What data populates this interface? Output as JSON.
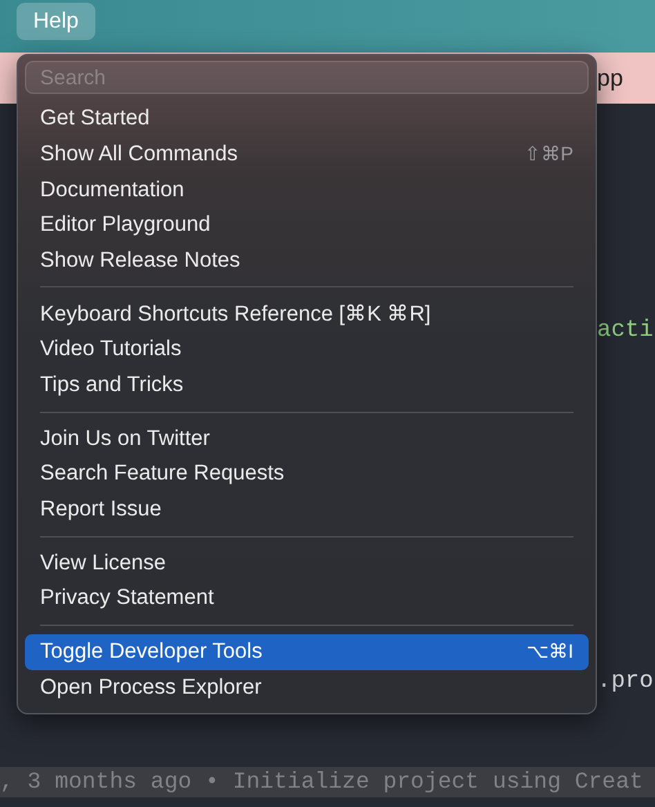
{
  "menubar": {
    "items": [
      {
        "label": "Help",
        "selected": true
      }
    ]
  },
  "banner": {
    "text": "pp"
  },
  "editor": {
    "fragments": [
      {
        "text": "acti",
        "kind": "string"
      },
      {
        "text": ".pro",
        "kind": "code"
      }
    ]
  },
  "blame": ", 3 months ago • Initialize project using Creat",
  "menu": {
    "search": {
      "placeholder": "Search"
    },
    "groups": [
      [
        {
          "label": "Get Started",
          "selected": false
        },
        {
          "label": "Show All Commands",
          "shortcut": "⇧⌘P",
          "selected": false
        },
        {
          "label": "Documentation",
          "selected": false
        },
        {
          "label": "Editor Playground",
          "selected": false
        },
        {
          "label": "Show Release Notes",
          "selected": false
        }
      ],
      [
        {
          "label": "Keyboard Shortcuts Reference [⌘K ⌘R]",
          "selected": false
        },
        {
          "label": "Video Tutorials",
          "selected": false
        },
        {
          "label": "Tips and Tricks",
          "selected": false
        }
      ],
      [
        {
          "label": "Join Us on Twitter",
          "selected": false
        },
        {
          "label": "Search Feature Requests",
          "selected": false
        },
        {
          "label": "Report Issue",
          "selected": false
        }
      ],
      [
        {
          "label": "View License",
          "selected": false
        },
        {
          "label": "Privacy Statement",
          "selected": false
        }
      ],
      [
        {
          "label": "Toggle Developer Tools",
          "shortcut": "⌥⌘I",
          "selected": true
        },
        {
          "label": "Open Process Explorer",
          "selected": false
        }
      ]
    ]
  }
}
